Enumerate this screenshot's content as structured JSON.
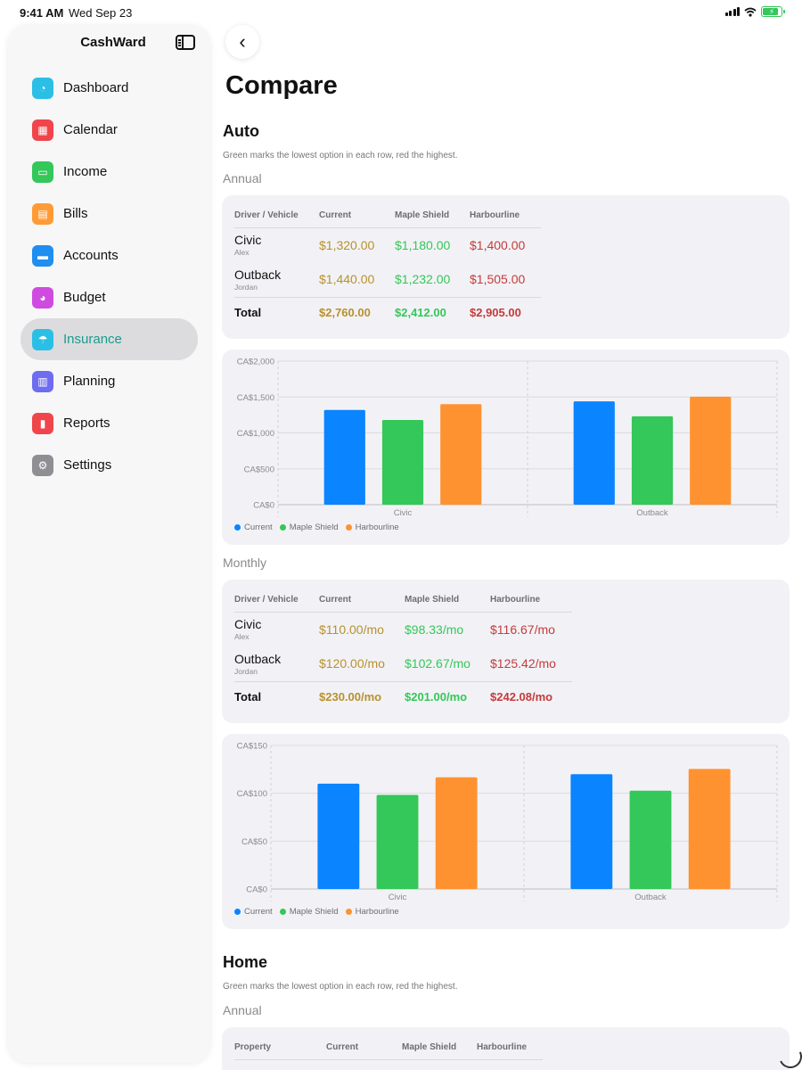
{
  "status_bar": {
    "time": "9:41 AM",
    "date": "Wed Sep 23"
  },
  "sidebar": {
    "title": "CashWard",
    "items": [
      {
        "label": "Dashboard",
        "icon": "gauge-icon",
        "color": "#2bbfe6",
        "glyph": "◔",
        "active": false
      },
      {
        "label": "Calendar",
        "icon": "calendar-icon",
        "color": "#f0454b",
        "glyph": "▦",
        "active": false
      },
      {
        "label": "Income",
        "icon": "cash-icon",
        "color": "#34c759",
        "glyph": "▭",
        "active": false
      },
      {
        "label": "Bills",
        "icon": "document-icon",
        "color": "#ff9b35",
        "glyph": "▤",
        "active": false
      },
      {
        "label": "Accounts",
        "icon": "card-icon",
        "color": "#1f8ef1",
        "glyph": "▬",
        "active": false
      },
      {
        "label": "Budget",
        "icon": "pie-chart-icon",
        "color": "#cf4be0",
        "glyph": "◕",
        "active": false
      },
      {
        "label": "Insurance",
        "icon": "umbrella-icon",
        "color": "#2bbfe6",
        "glyph": "☂",
        "active": true
      },
      {
        "label": "Planning",
        "icon": "map-icon",
        "color": "#6e6cf0",
        "glyph": "▥",
        "active": false
      },
      {
        "label": "Reports",
        "icon": "bar-chart-icon",
        "color": "#f0454b",
        "glyph": "▮",
        "active": false
      },
      {
        "label": "Settings",
        "icon": "gear-icon",
        "color": "#8e8e93",
        "glyph": "⚙",
        "active": false
      }
    ]
  },
  "page": {
    "title": "Compare"
  },
  "auto": {
    "heading": "Auto",
    "hint": "Green marks the lowest option in each row, red the highest.",
    "annual": {
      "label": "Annual",
      "headers": [
        "Driver / Vehicle",
        "Current",
        "Maple Shield",
        "Harbourline"
      ],
      "rows": [
        {
          "name": "Civic",
          "person": "Alex",
          "values": [
            "$1,320.00",
            "$1,180.00",
            "$1,400.00"
          ]
        },
        {
          "name": "Outback",
          "person": "Jordan",
          "values": [
            "$1,440.00",
            "$1,232.00",
            "$1,505.00"
          ]
        }
      ],
      "total": {
        "label": "Total",
        "values": [
          "$2,760.00",
          "$2,412.00",
          "$2,905.00"
        ]
      }
    },
    "monthly": {
      "label": "Monthly",
      "headers": [
        "Driver / Vehicle",
        "Current",
        "Maple Shield",
        "Harbourline"
      ],
      "rows": [
        {
          "name": "Civic",
          "person": "Alex",
          "values": [
            "$110.00/mo",
            "$98.33/mo",
            "$116.67/mo"
          ]
        },
        {
          "name": "Outback",
          "person": "Jordan",
          "values": [
            "$120.00/mo",
            "$102.67/mo",
            "$125.42/mo"
          ]
        }
      ],
      "total": {
        "label": "Total",
        "values": [
          "$230.00/mo",
          "$201.00/mo",
          "$242.08/mo"
        ]
      }
    }
  },
  "home": {
    "heading": "Home",
    "hint": "Green marks the lowest option in each row, red the highest.",
    "annual": {
      "label": "Annual",
      "headers": [
        "Property",
        "Current",
        "Maple Shield",
        "Harbourline"
      ]
    }
  },
  "legend": [
    {
      "name": "Current",
      "color": "#0a84ff"
    },
    {
      "name": "Maple Shield",
      "color": "#34c759"
    },
    {
      "name": "Harbourline",
      "color": "#ff9230"
    }
  ],
  "chart_data": [
    {
      "type": "bar",
      "categories": [
        "Civic",
        "Outback"
      ],
      "series": [
        {
          "name": "Current",
          "values": [
            1320,
            1440
          ]
        },
        {
          "name": "Maple Shield",
          "values": [
            1180,
            1232
          ]
        },
        {
          "name": "Harbourline",
          "values": [
            1400,
            1505
          ]
        }
      ],
      "yticks": [
        "CA$0",
        "CA$500",
        "CA$1,000",
        "CA$1,500",
        "CA$2,000"
      ],
      "ytick_values": [
        0,
        500,
        1000,
        1500,
        2000
      ],
      "ylim": [
        0,
        2000
      ],
      "grid": true,
      "legend": "bottom-left",
      "colors": [
        "#0a84ff",
        "#34c759",
        "#ff9230"
      ]
    },
    {
      "type": "bar",
      "categories": [
        "Civic",
        "Outback"
      ],
      "series": [
        {
          "name": "Current",
          "values": [
            110,
            120
          ]
        },
        {
          "name": "Maple Shield",
          "values": [
            98.33,
            102.67
          ]
        },
        {
          "name": "Harbourline",
          "values": [
            116.67,
            125.42
          ]
        }
      ],
      "yticks": [
        "CA$0",
        "CA$50",
        "CA$100",
        "CA$150"
      ],
      "ytick_values": [
        0,
        50,
        100,
        150
      ],
      "ylim": [
        0,
        150
      ],
      "grid": true,
      "legend": "bottom-left",
      "colors": [
        "#0a84ff",
        "#34c759",
        "#ff9230"
      ]
    }
  ]
}
